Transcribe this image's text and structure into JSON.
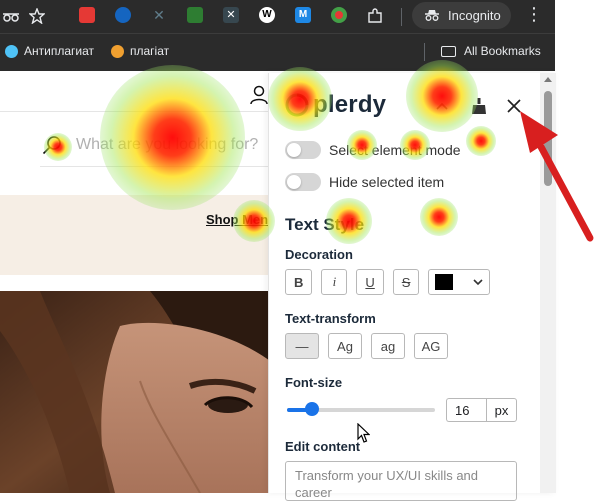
{
  "browser": {
    "incognito_label": "Incognito",
    "bookmarks": [
      {
        "label": "Антиплагиат",
        "color": "#4fc3f7"
      },
      {
        "label": "плагіат",
        "color": "#f0a030"
      }
    ],
    "all_bookmarks_label": "All Bookmarks",
    "extension_colors": [
      "#e53935",
      "#1565c0",
      "#263238",
      "#2e7d32",
      "#37474f",
      "#424242",
      "#1e88e5",
      "#e53935"
    ]
  },
  "page": {
    "search_placeholder": "What are you looking for?",
    "shop_link": "Shop Men"
  },
  "panel": {
    "logo_text": "plerdy",
    "toggles": [
      {
        "label": "Select element mode",
        "on": false
      },
      {
        "label": "Hide selected item",
        "on": false
      }
    ],
    "section_title": "Text Style",
    "decoration": {
      "label": "Decoration",
      "buttons": [
        "B",
        "i",
        "U",
        "S"
      ],
      "color": "#000000"
    },
    "text_transform": {
      "label": "Text-transform",
      "buttons": [
        "—",
        "Ag",
        "ag",
        "AG"
      ],
      "selected": "—"
    },
    "font_size": {
      "label": "Font-size",
      "value": "16",
      "unit": "px",
      "slider_fraction": 0.17
    },
    "edit_content": {
      "label": "Edit content",
      "text": "Transform your UX/UI skills and career"
    }
  },
  "accent": "#1a73e8"
}
